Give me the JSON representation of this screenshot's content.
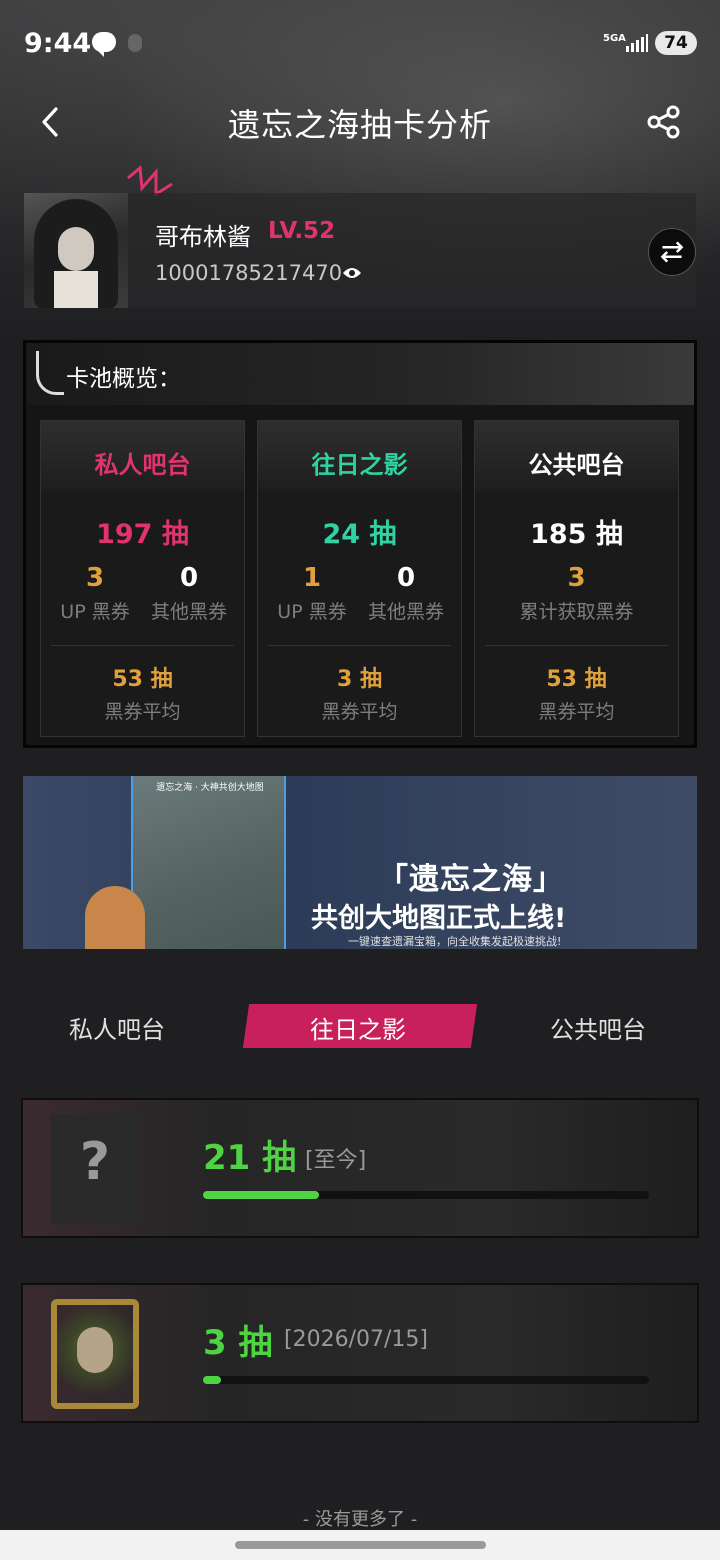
{
  "status_bar": {
    "time": "9:44",
    "network": "5GA",
    "battery": "74"
  },
  "header": {
    "title": "遗忘之海抽卡分析"
  },
  "profile": {
    "name": "哥布林酱",
    "level": "LV.52",
    "uid": "10001785217470"
  },
  "overview": {
    "title": "卡池概览：",
    "pools": [
      {
        "name": "私人吧台",
        "total": "197 抽",
        "accent": "#e0336f",
        "stat1_num": "3",
        "stat1_label": "UP 黑券",
        "stat2_num": "0",
        "stat2_label": "其他黑券",
        "avg": "53 抽",
        "avg_label": "黑券平均"
      },
      {
        "name": "往日之影",
        "total": "24 抽",
        "accent": "#2fd2a0",
        "stat1_num": "1",
        "stat1_label": "UP 黑券",
        "stat2_num": "0",
        "stat2_label": "其他黑券",
        "avg": "3 抽",
        "avg_label": "黑券平均"
      },
      {
        "name": "公共吧台",
        "total": "185 抽",
        "accent": "#ffffff",
        "stat1_num": "3",
        "stat1_label": "累计获取黑券",
        "avg": "53 抽",
        "avg_label": "黑券平均"
      }
    ]
  },
  "banner": {
    "map_title": "遗忘之海 · 大神共创大地图",
    "title_line1": "「遗忘之海」",
    "title_line2": "共创大地图正式上线!",
    "subtitle": "一键速查遗漏宝箱，向全收集发起极速挑战!"
  },
  "tabs": [
    {
      "label": "私人吧台",
      "active": false
    },
    {
      "label": "往日之影",
      "active": true
    },
    {
      "label": "公共吧台",
      "active": false
    }
  ],
  "records": [
    {
      "count": "21 抽",
      "tag": "[至今]",
      "progress": 0.26,
      "thumb": "?"
    },
    {
      "count": "3 抽",
      "tag": "[2026/07/15]",
      "progress": 0.04,
      "thumb": "portrait"
    }
  ],
  "footer": {
    "text": "- 没有更多了 -"
  },
  "colors": {
    "accent_pink": "#e0336f",
    "accent_teal": "#2fd2a0",
    "accent_orange": "#e0a03c",
    "progress_green": "#4ed442",
    "background": "#1f1f21"
  },
  "icons": [
    "back-icon",
    "share-icon",
    "eye-icon",
    "swap-icon",
    "chat-icon",
    "signal-icon",
    "battery-icon"
  ]
}
